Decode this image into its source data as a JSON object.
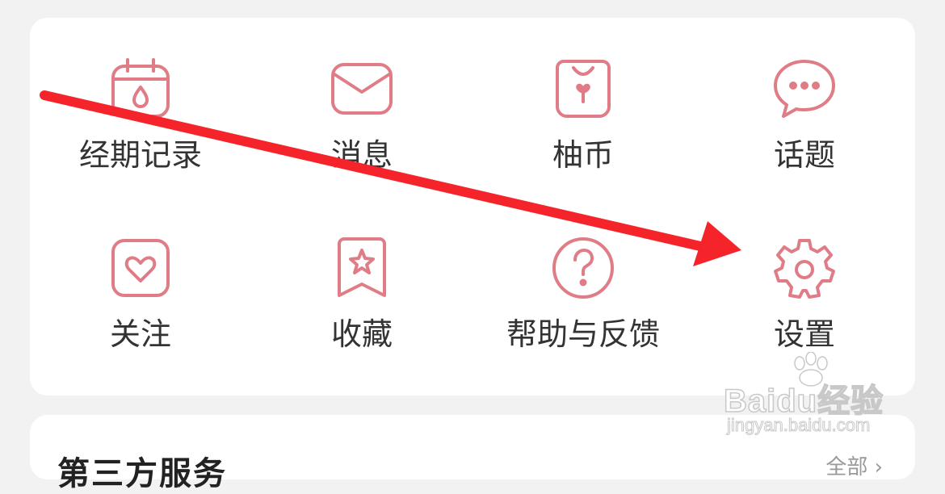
{
  "menu": {
    "items": [
      {
        "label": "经期记录",
        "icon": "calendar-drop-icon"
      },
      {
        "label": "消息",
        "icon": "envelope-icon"
      },
      {
        "label": "柚币",
        "icon": "coin-bag-icon"
      },
      {
        "label": "话题",
        "icon": "chat-bubble-icon"
      },
      {
        "label": "关注",
        "icon": "heart-icon"
      },
      {
        "label": "收藏",
        "icon": "star-bookmark-icon"
      },
      {
        "label": "帮助与反馈",
        "icon": "help-icon"
      },
      {
        "label": "设置",
        "icon": "gear-icon"
      }
    ]
  },
  "third_party": {
    "title": "第三方服务",
    "more_label": "全部 ›"
  },
  "watermark": {
    "brand": "Baidu经验",
    "site": "jingyan.baidu.com"
  },
  "colors": {
    "icon_stroke": "#e07c86",
    "annotation_arrow": "#f5242a",
    "text": "#333333",
    "page_bg": "#f2f2f2",
    "card_bg": "#ffffff"
  }
}
